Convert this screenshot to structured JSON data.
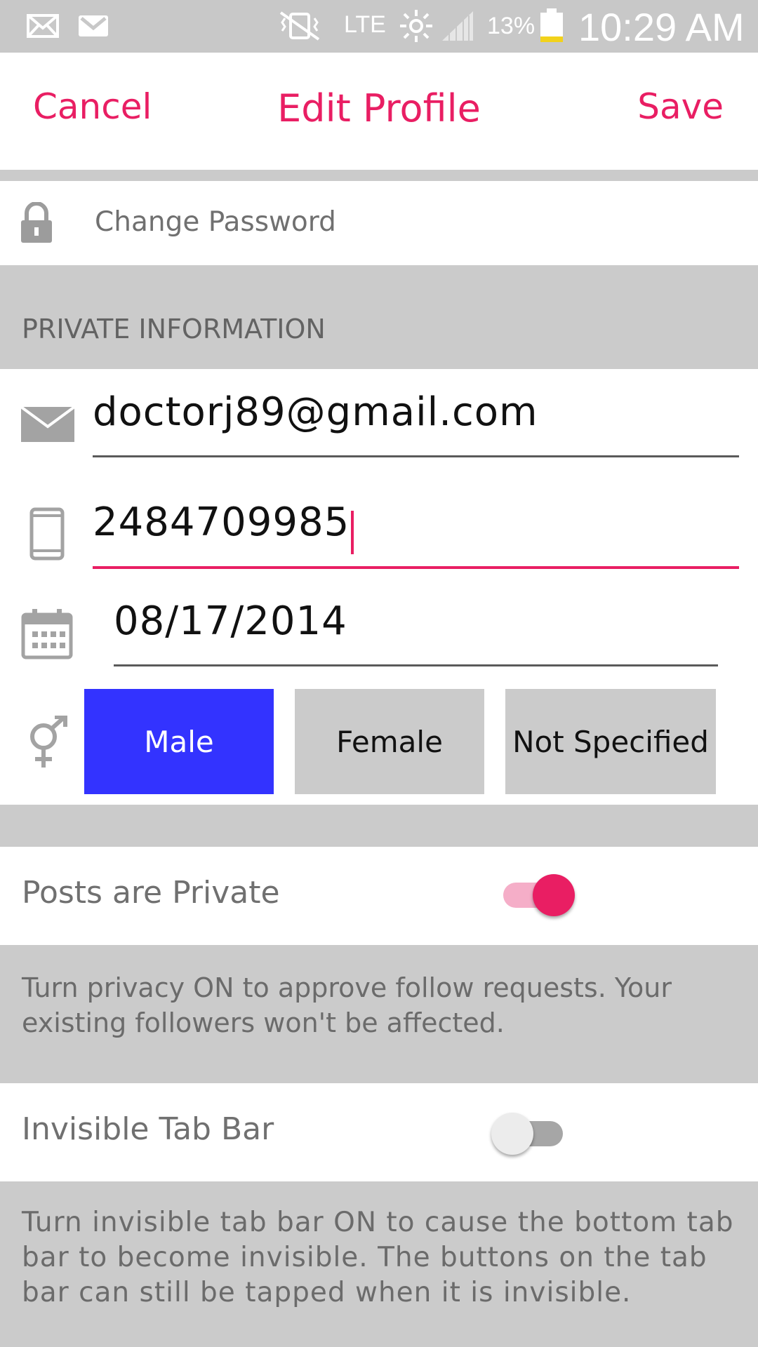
{
  "status_bar": {
    "time": "10:29 AM",
    "battery": "13%",
    "network": "LTE",
    "icons": [
      "mail-icon",
      "gmail-icon",
      "vibrate-icon",
      "brightness-icon",
      "signal-icon",
      "battery-icon"
    ]
  },
  "header": {
    "cancel_label": "Cancel",
    "title": "Edit Profile",
    "save_label": "Save"
  },
  "change_password": {
    "label": "Change Password",
    "icon": "lock-icon"
  },
  "private_info": {
    "section_title": "PRIVATE INFORMATION",
    "email": {
      "value": "doctorj89@gmail.com",
      "icon": "envelope-icon"
    },
    "phone": {
      "value": "2484709985",
      "icon": "phone-icon"
    },
    "birthdate": {
      "value": "08/17/2014",
      "icon": "calendar-icon"
    },
    "gender": {
      "icon": "gender-icon",
      "options": [
        "Male",
        "Female",
        "Not Specified"
      ],
      "selected": "Male"
    }
  },
  "settings": {
    "private_posts": {
      "label": "Posts are Private",
      "on": true,
      "description": "Turn privacy ON to approve follow requests. Your existing followers won't be affected."
    },
    "invisible_tab_bar": {
      "label": "Invisible Tab Bar",
      "on": false,
      "description": "Turn invisible tab bar ON to cause the bottom tab bar to become invisible. The buttons on the tab bar can still be tapped when it is invisible."
    }
  },
  "colors": {
    "accent": "#e91e63",
    "selected_button": "#3333ff",
    "section_background": "#cbcbcb"
  }
}
